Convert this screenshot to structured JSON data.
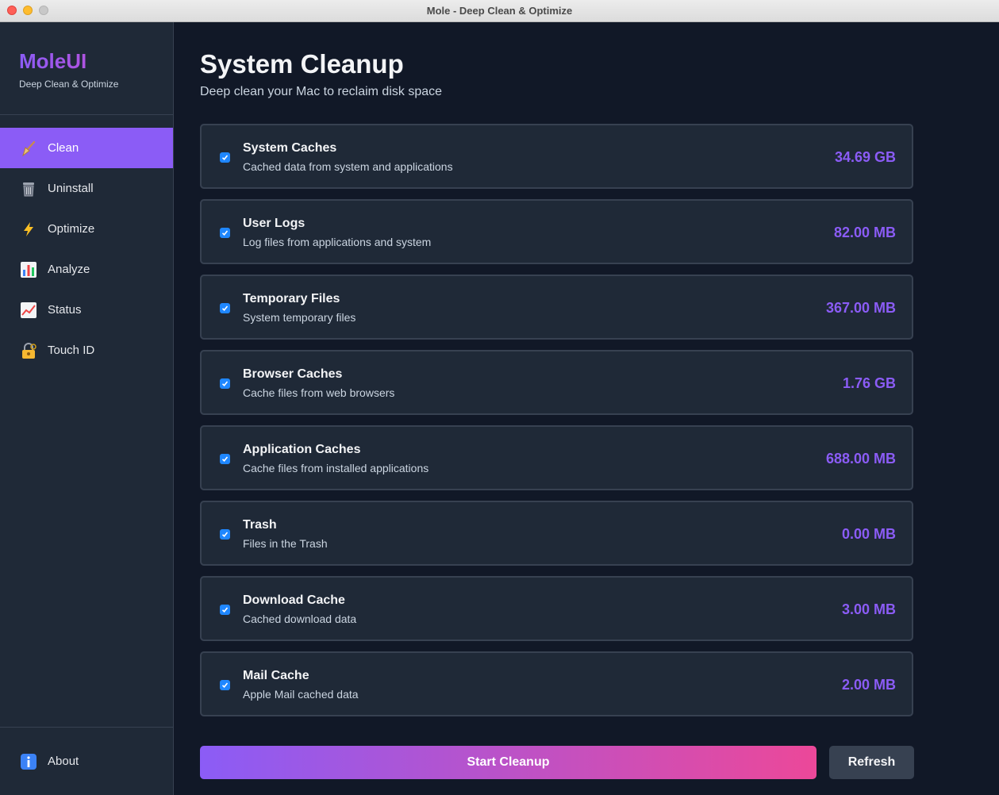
{
  "window": {
    "title": "Mole - Deep Clean & Optimize"
  },
  "sidebar": {
    "brand_title": "MoleUI",
    "brand_subtitle": "Deep Clean & Optimize",
    "items": [
      {
        "label": "Clean",
        "icon": "broom-icon",
        "active": true
      },
      {
        "label": "Uninstall",
        "icon": "trash-can-icon",
        "active": false
      },
      {
        "label": "Optimize",
        "icon": "lightning-icon",
        "active": false
      },
      {
        "label": "Analyze",
        "icon": "bar-chart-icon",
        "active": false
      },
      {
        "label": "Status",
        "icon": "line-chart-icon",
        "active": false
      },
      {
        "label": "Touch ID",
        "icon": "lock-key-icon",
        "active": false
      }
    ],
    "about_label": "About",
    "about_icon": "info-icon"
  },
  "main": {
    "title": "System Cleanup",
    "subtitle": "Deep clean your Mac to reclaim disk space",
    "items": [
      {
        "title": "System Caches",
        "description": "Cached data from system and applications",
        "size": "34.69 GB",
        "checked": true
      },
      {
        "title": "User Logs",
        "description": "Log files from applications and system",
        "size": "82.00 MB",
        "checked": true
      },
      {
        "title": "Temporary Files",
        "description": "System temporary files",
        "size": "367.00 MB",
        "checked": true
      },
      {
        "title": "Browser Caches",
        "description": "Cache files from web browsers",
        "size": "1.76 GB",
        "checked": true
      },
      {
        "title": "Application Caches",
        "description": "Cache files from installed applications",
        "size": "688.00 MB",
        "checked": true
      },
      {
        "title": "Trash",
        "description": "Files in the Trash",
        "size": "0.00 MB",
        "checked": true
      },
      {
        "title": "Download Cache",
        "description": "Cached download data",
        "size": "3.00 MB",
        "checked": true
      },
      {
        "title": "Mail Cache",
        "description": "Apple Mail cached data",
        "size": "2.00 MB",
        "checked": true
      }
    ],
    "start_button": "Start Cleanup",
    "refresh_button": "Refresh"
  },
  "colors": {
    "accent": "#8b5cf6",
    "gradient_end": "#ec4899",
    "checkbox": "#1f87ff",
    "sidebar_bg": "#1f2937",
    "main_bg": "#111827"
  }
}
